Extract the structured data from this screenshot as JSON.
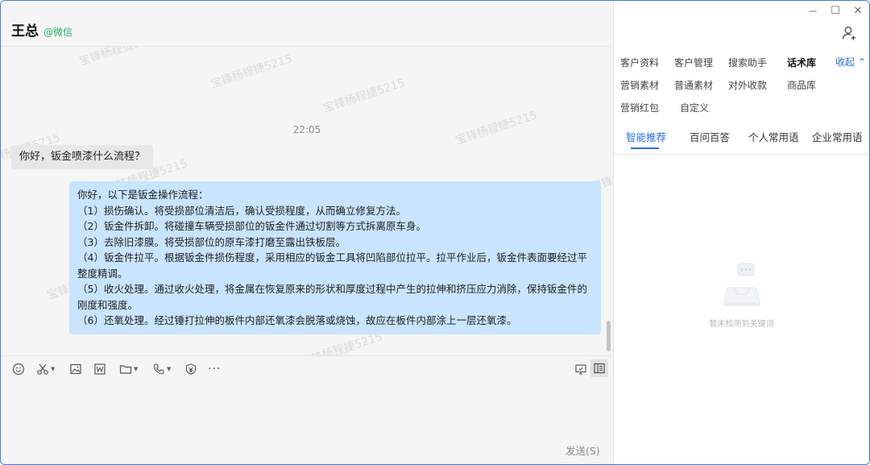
{
  "contact": {
    "name": "王总",
    "source": "@微信"
  },
  "watermark_text": "宝锋杨程捷5215",
  "chat": {
    "time": "22:05",
    "incoming_message": "你好，钣金喷漆什么流程？",
    "outgoing_message": {
      "lines": [
        "你好，以下是钣金操作流程：",
        "（1）损伤确认。将受损部位清洁后，确认受损程度，从而确立修复方法。",
        "（2）钣金件拆卸。将碰撞车辆受损部位的钣金件通过切割等方式拆离原车身。",
        "（3）去除旧漆膜。将受损部位的原车漆打磨至露出铁板层。",
        "（4）钣金件拉平。根据钣金件损伤程度，采用相应的钣金工具将凹陷部位拉平。拉平作业后，钣金件表面要经过平整度精调。",
        "（5）收火处理。通过收火处理，将金属在恢复原来的形状和厚度过程中产生的拉伸和挤压应力消除，保持钣金件的刚度和强度。",
        "（6）还氧处理。经过锤打拉伸的板件内部还氧漆会脱落或烧蚀，故应在板件内部涂上一层还氧漆。"
      ]
    }
  },
  "toolbar": {
    "icons": [
      "emoji-icon",
      "scissors-icon",
      "image-icon",
      "word-icon",
      "folder-icon",
      "phone-icon",
      "red-packet-icon",
      "more-icon",
      "screen-icon",
      "sidebar-icon"
    ],
    "more_label": "···"
  },
  "input": {
    "send_label": "发送(S)"
  },
  "window_controls": {
    "minimize": "－",
    "maximize": "☐",
    "close": "✕"
  },
  "right_panel": {
    "menu": [
      [
        "客户资料",
        "客户管理",
        "搜索助手",
        "话术库"
      ],
      [
        "营销素材",
        "普通素材",
        "对外收款",
        "商品库"
      ],
      [
        "营销红包",
        "自定义"
      ]
    ],
    "active_menu": "话术库",
    "collapse_label": "收起 ⌃",
    "tabs": [
      "智能推荐",
      "百问百答",
      "个人常用语",
      "企业常用语"
    ],
    "active_tab": "智能推荐",
    "empty_text": "暂未检测到关键词"
  },
  "colors": {
    "accent": "#2a6fd6",
    "source_green": "#2aae67",
    "outgoing_bubble": "#c9e4ff",
    "incoming_bubble": "#e7e7e7",
    "border": "#3a7fd5"
  }
}
